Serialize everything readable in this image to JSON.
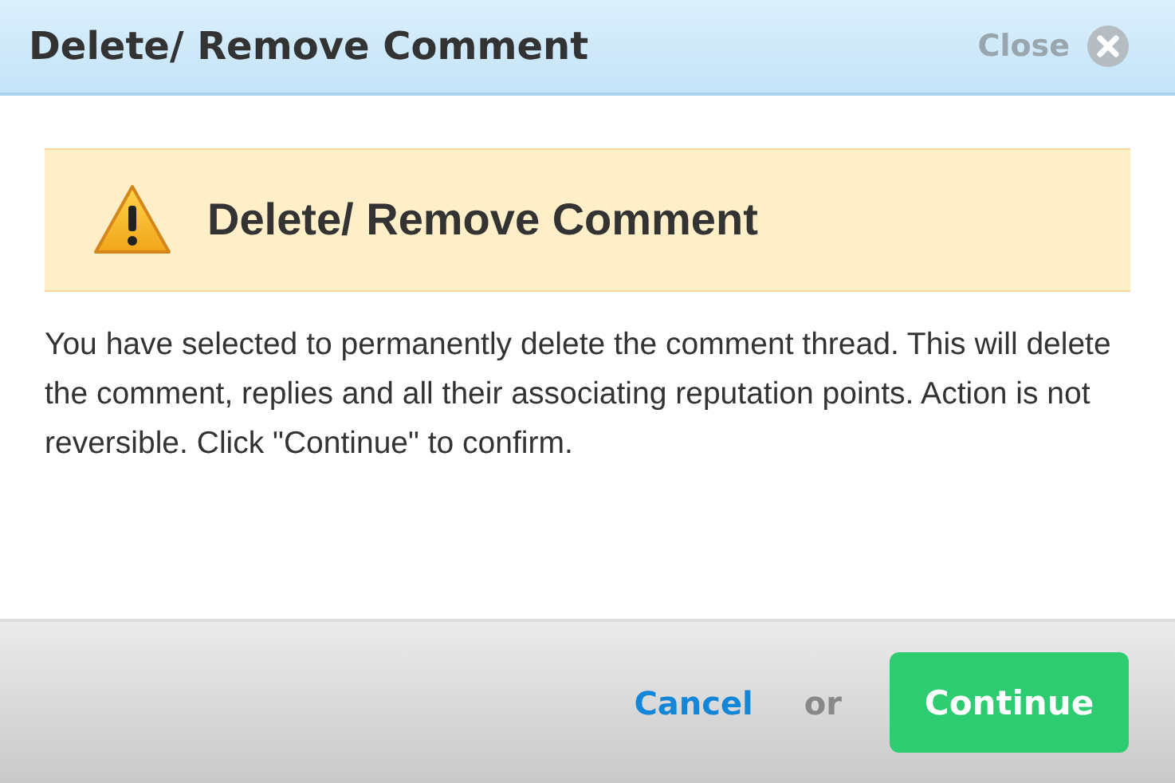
{
  "dialog": {
    "title": "Delete/ Remove Comment",
    "close_label": "Close"
  },
  "alert": {
    "heading": "Delete/ Remove Comment"
  },
  "message": "You have selected to permanently delete the comment thread. This will delete the comment, replies and all their associating reputation points. Action is not reversible. Click \"Continue\" to confirm.",
  "footer": {
    "cancel": "Cancel",
    "separator": "or",
    "confirm": "Continue"
  }
}
